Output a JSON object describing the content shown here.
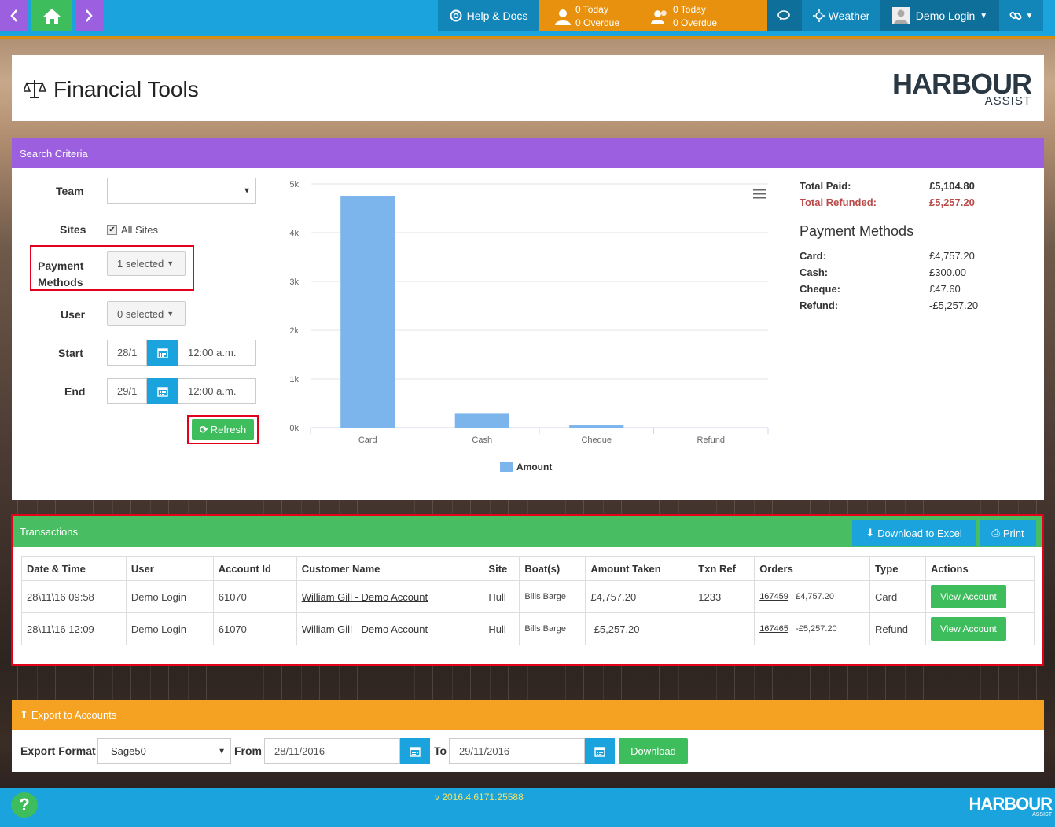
{
  "nav": {
    "help_label": "Help & Docs",
    "tasks_today_1": "0 Today",
    "tasks_overdue_1": "0 Overdue",
    "tasks_today_2": "0 Today",
    "tasks_overdue_2": "0 Overdue",
    "weather_label": "Weather",
    "user_label": "Demo Login"
  },
  "page": {
    "title": "Financial Tools",
    "logo_main": "HARBOUR",
    "logo_sub": "ASSIST"
  },
  "search": {
    "header": "Search Criteria",
    "team_label": "Team",
    "team_value": "",
    "sites_label": "Sites",
    "all_sites_label": "All Sites",
    "all_sites_checked": true,
    "payment_label_1": "Payment",
    "payment_label_2": "Methods",
    "payment_value": "1 selected",
    "user_label": "User",
    "user_value": "0 selected",
    "start_label": "Start",
    "start_date": "28/1",
    "start_time": "12:00 a.m.",
    "end_label": "End",
    "end_date": "29/1",
    "end_time": "12:00 a.m.",
    "refresh_label": "Refresh"
  },
  "chart_data": {
    "type": "bar",
    "categories": [
      "Card",
      "Cash",
      "Cheque",
      "Refund"
    ],
    "series": [
      {
        "name": "Amount",
        "values": [
          4757.2,
          300.0,
          47.6,
          0
        ],
        "color": "#7cb5ec"
      }
    ],
    "ylim": [
      0,
      5000
    ],
    "yticks": [
      "0k",
      "1k",
      "2k",
      "3k",
      "4k",
      "5k"
    ],
    "legend": "bottom",
    "grid": true
  },
  "totals": {
    "paid_label": "Total Paid:",
    "paid_value": "£5,104.80",
    "refunded_label": "Total Refunded:",
    "refunded_value": "£5,257.20",
    "refund_color": "#b94a48",
    "pm_title": "Payment Methods",
    "methods": [
      {
        "label": "Card:",
        "value": "£4,757.20"
      },
      {
        "label": "Cash:",
        "value": "£300.00"
      },
      {
        "label": "Cheque:",
        "value": "£47.60"
      },
      {
        "label": "Refund:",
        "value": "-£5,257.20"
      }
    ]
  },
  "transactions": {
    "header": "Transactions",
    "download_label": "Download to Excel",
    "print_label": "Print",
    "columns": [
      "Date & Time",
      "User",
      "Account Id",
      "Customer Name",
      "Site",
      "Boat(s)",
      "Amount Taken",
      "Txn Ref",
      "Orders",
      "Type",
      "Actions"
    ],
    "rows": [
      {
        "datetime": "28\\11\\16 09:58",
        "user": "Demo Login",
        "account": "61070",
        "customer": "William Gill - Demo Account",
        "site": "Hull",
        "boats": "Bills Barge",
        "amount": "£4,757.20",
        "txn": "1233",
        "order_id": "167459",
        "order_amt": " : £4,757.20",
        "type": "Card",
        "action": "View Account"
      },
      {
        "datetime": "28\\11\\16 12:09",
        "user": "Demo Login",
        "account": "61070",
        "customer": "William Gill - Demo Account",
        "site": "Hull",
        "boats": "Bills Barge",
        "amount": "-£5,257.20",
        "txn": "",
        "order_id": "167465",
        "order_amt": " : -£5,257.20",
        "type": "Refund",
        "action": "View Account"
      }
    ]
  },
  "export": {
    "header": "Export to Accounts",
    "format_label": "Export Format",
    "format_value": "Sage50",
    "from_label": "From",
    "from_value": "28/11/2016",
    "to_label": "To",
    "to_value": "29/11/2016",
    "download_label": "Download"
  },
  "footer": {
    "version": "v 2016.4.6171.25588",
    "help": "?",
    "logo_main": "HARBOUR",
    "logo_sub": "ASSIST"
  }
}
